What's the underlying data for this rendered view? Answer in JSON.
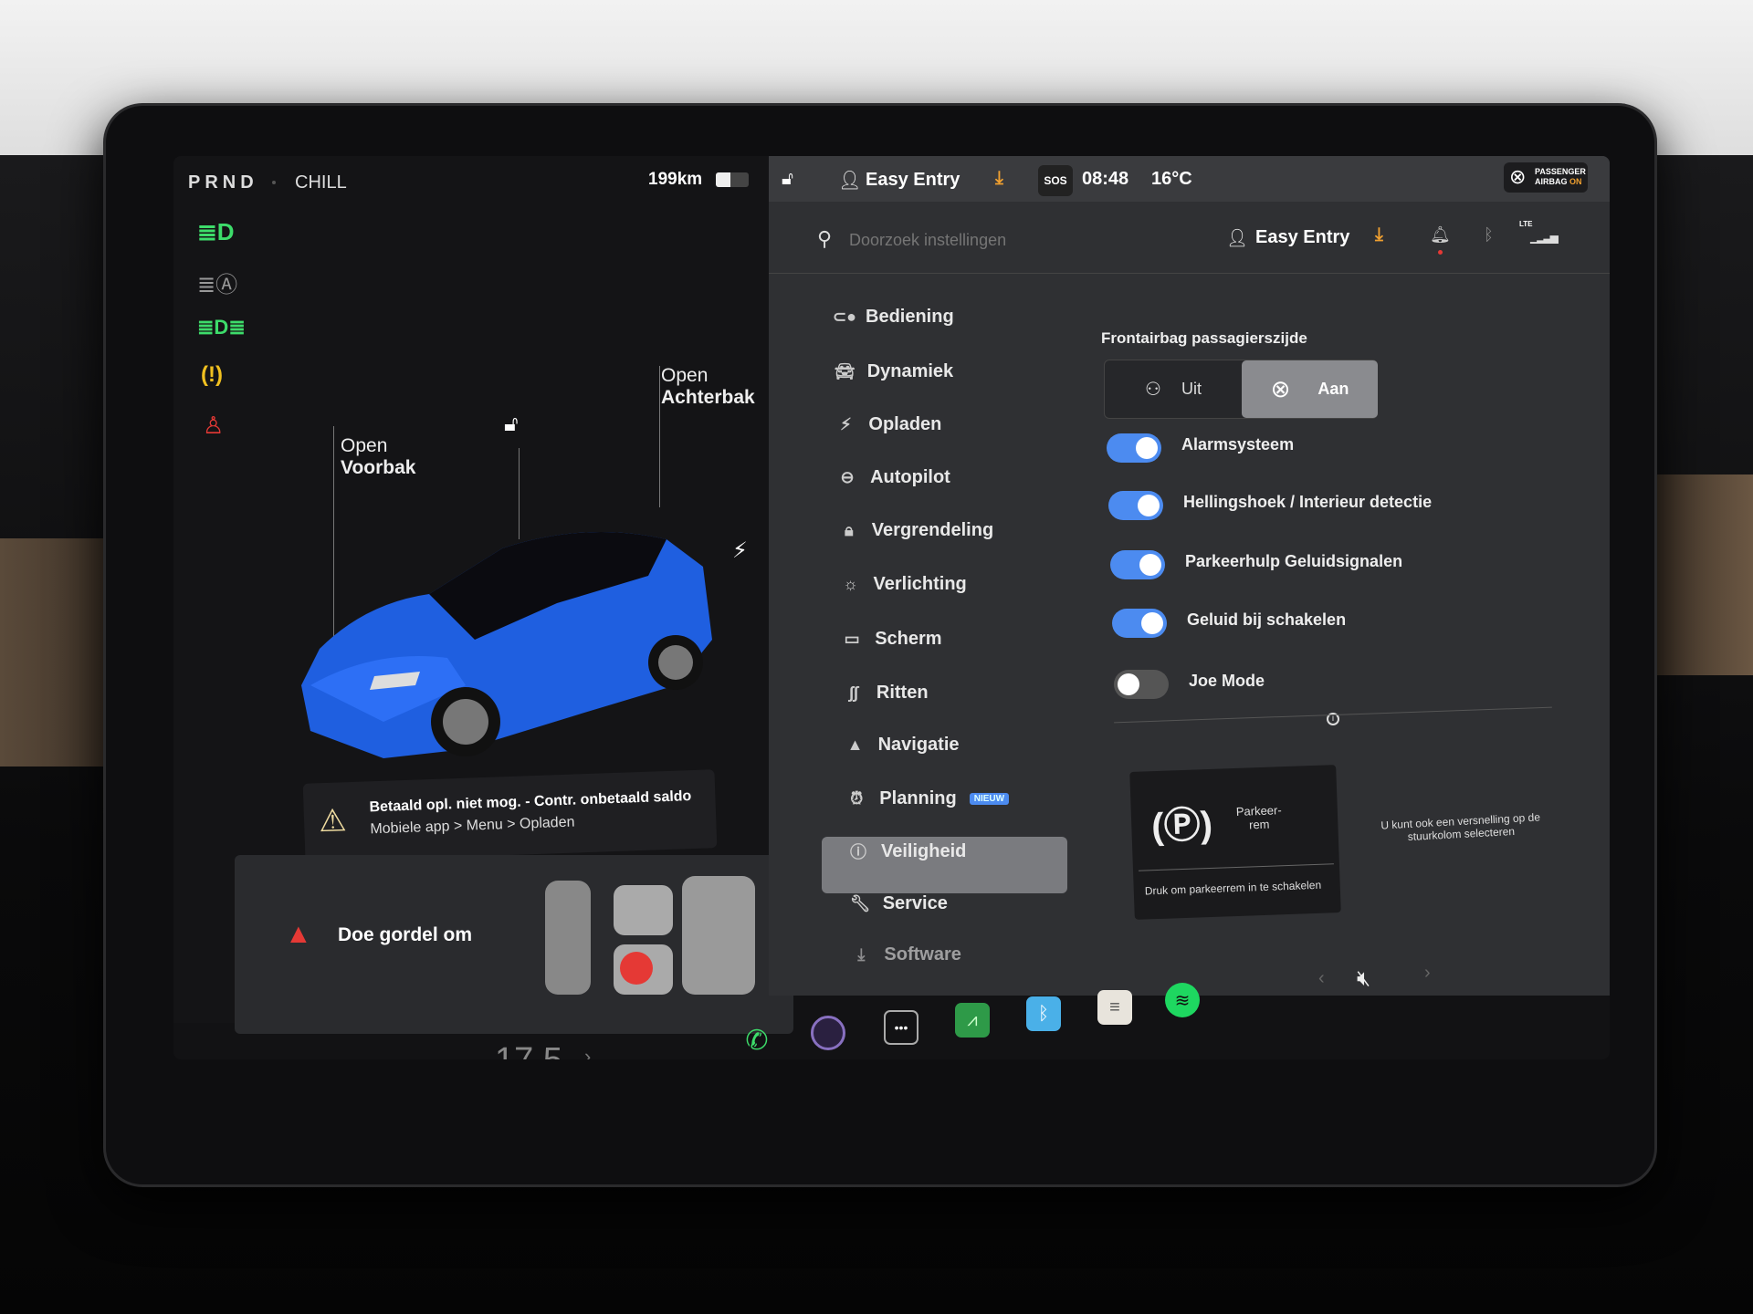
{
  "status": {
    "gears": "PRND",
    "mode": "CHILL",
    "range": "199km",
    "battery_level": 0.45,
    "time": "08:48",
    "temperature": "16°C",
    "sos": "SOS",
    "passenger_airbag": {
      "line1": "PASSENGER",
      "line2": "AIRBAG",
      "state": "ON"
    },
    "profile": "Easy Entry"
  },
  "car": {
    "frunk": {
      "line1": "Open",
      "line2": "Voorbak"
    },
    "trunk": {
      "line1": "Open",
      "line2": "Achterbak"
    }
  },
  "alert": {
    "title": "Betaald opl. niet mog. - Contr. onbetaald saldo",
    "subtitle": "Mobiele app > Menu > Opladen"
  },
  "seatbelt": {
    "message": "Doe gordel om"
  },
  "search": {
    "placeholder": "Doorzoek instellingen",
    "profile": "Easy Entry",
    "network": "LTE"
  },
  "menu": [
    {
      "label": "Bediening",
      "icon": "toggle-icon"
    },
    {
      "label": "Dynamiek",
      "icon": "car-icon"
    },
    {
      "label": "Opladen",
      "icon": "bolt-icon"
    },
    {
      "label": "Autopilot",
      "icon": "steering-wheel-icon"
    },
    {
      "label": "Vergrendeling",
      "icon": "lock-icon"
    },
    {
      "label": "Verlichting",
      "icon": "sun-icon"
    },
    {
      "label": "Scherm",
      "icon": "display-icon"
    },
    {
      "label": "Ritten",
      "icon": "trips-icon"
    },
    {
      "label": "Navigatie",
      "icon": "navigation-icon"
    },
    {
      "label": "Planning",
      "icon": "alarm-icon",
      "badge": "NIEUW"
    },
    {
      "label": "Veiligheid",
      "icon": "alert-circle-icon",
      "active": true
    },
    {
      "label": "Service",
      "icon": "wrench-icon"
    },
    {
      "label": "Software",
      "icon": "download-icon"
    }
  ],
  "safety": {
    "airbag_label": "Frontairbag passagierszijde",
    "airbag_options": [
      "Uit",
      "Aan"
    ],
    "airbag_selected": "Aan",
    "toggles": [
      {
        "label": "Alarmsysteem",
        "on": true
      },
      {
        "label": "Hellingshoek / Interieur detectie",
        "on": true
      },
      {
        "label": "Parkeerhulp Geluidsignalen",
        "on": true
      },
      {
        "label": "Geluid bij schakelen",
        "on": true
      },
      {
        "label": "Joe Mode",
        "on": false
      }
    ],
    "parking_brake": {
      "title": "Parkeer-\nrem",
      "action": "Druk om parkeerrem in te schakelen"
    },
    "hint": "U kunt ook een versnelling op de stuurkolom selecteren"
  },
  "climate": {
    "temperature": "17.5"
  },
  "colors": {
    "accent": "#4c8bf0",
    "download": "#f0a030",
    "green": "#3ddc6a",
    "alert_red": "#e53935"
  }
}
